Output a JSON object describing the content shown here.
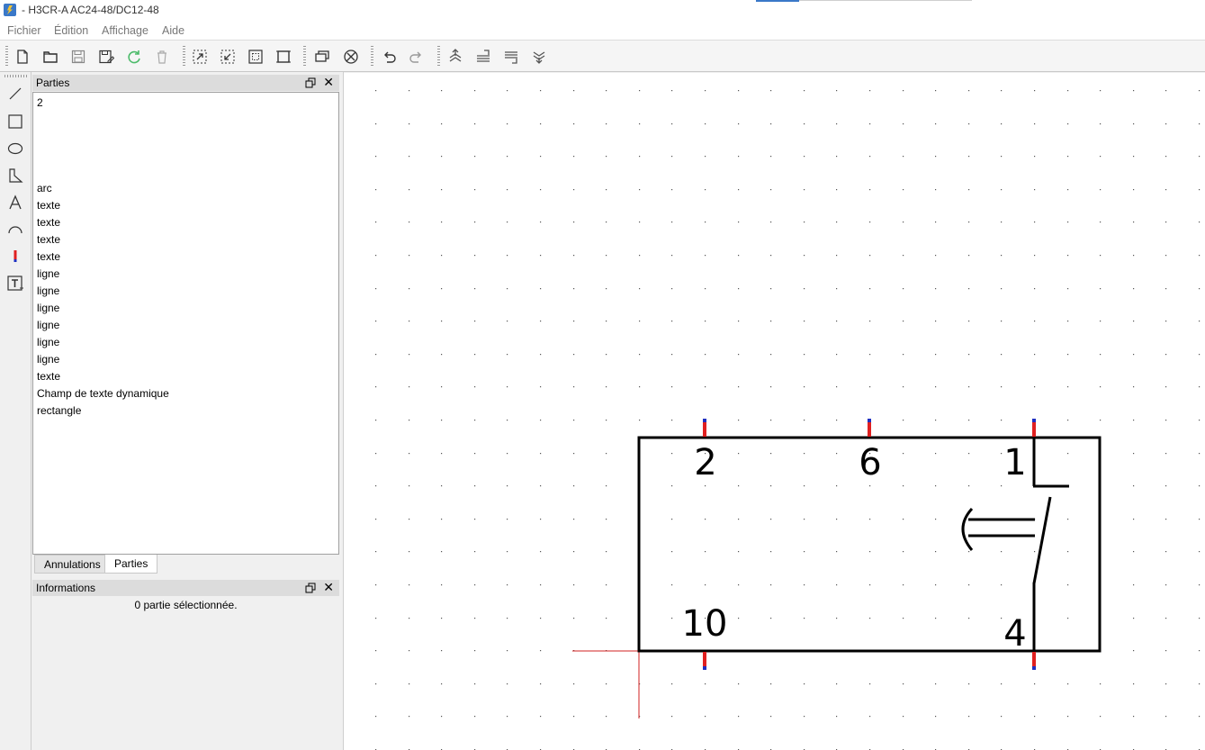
{
  "window": {
    "title": "- H3CR-A AC24-48/DC12-48"
  },
  "menu": {
    "items": [
      "Fichier",
      "Édition",
      "Affichage",
      "Aide"
    ]
  },
  "toolbar": {
    "icons": [
      "new-file-icon",
      "open-file-icon",
      "save-icon",
      "save-as-icon",
      "reload-icon",
      "delete-icon",
      "zoom-in-icon",
      "zoom-out-icon",
      "zoom-fit-icon",
      "zoom-reset-icon",
      "properties-icon",
      "no-pin-icon",
      "undo-icon",
      "redo-icon",
      "bring-front-icon",
      "raise-icon",
      "lower-icon",
      "send-back-icon"
    ]
  },
  "tools": {
    "icons": [
      "line-icon",
      "rectangle-icon",
      "ellipse-icon",
      "polygon-icon",
      "text-icon",
      "arc-icon",
      "terminal-icon",
      "dynamic-text-icon"
    ]
  },
  "parts_panel": {
    "title": "Parties",
    "items": [
      "2",
      "",
      "",
      "",
      "",
      "arc",
      "texte",
      "texte",
      "texte",
      "texte",
      "ligne",
      "ligne",
      "ligne",
      "ligne",
      "ligne",
      "ligne",
      "texte",
      "Champ de texte dynamique",
      "rectangle"
    ]
  },
  "tabs": {
    "undo": "Annulations",
    "parts": "Parties",
    "active": "Parties"
  },
  "info_panel": {
    "title": "Informations",
    "status": "0 partie sélectionnée."
  },
  "symbol": {
    "labels": {
      "pin2": "2",
      "pin6": "6",
      "pin1": "1",
      "pin10": "10",
      "pin4": "4"
    },
    "terminal_color": "#e02020",
    "terminal_tip_color": "#2030c0",
    "crosshair_color": "#d02020"
  }
}
